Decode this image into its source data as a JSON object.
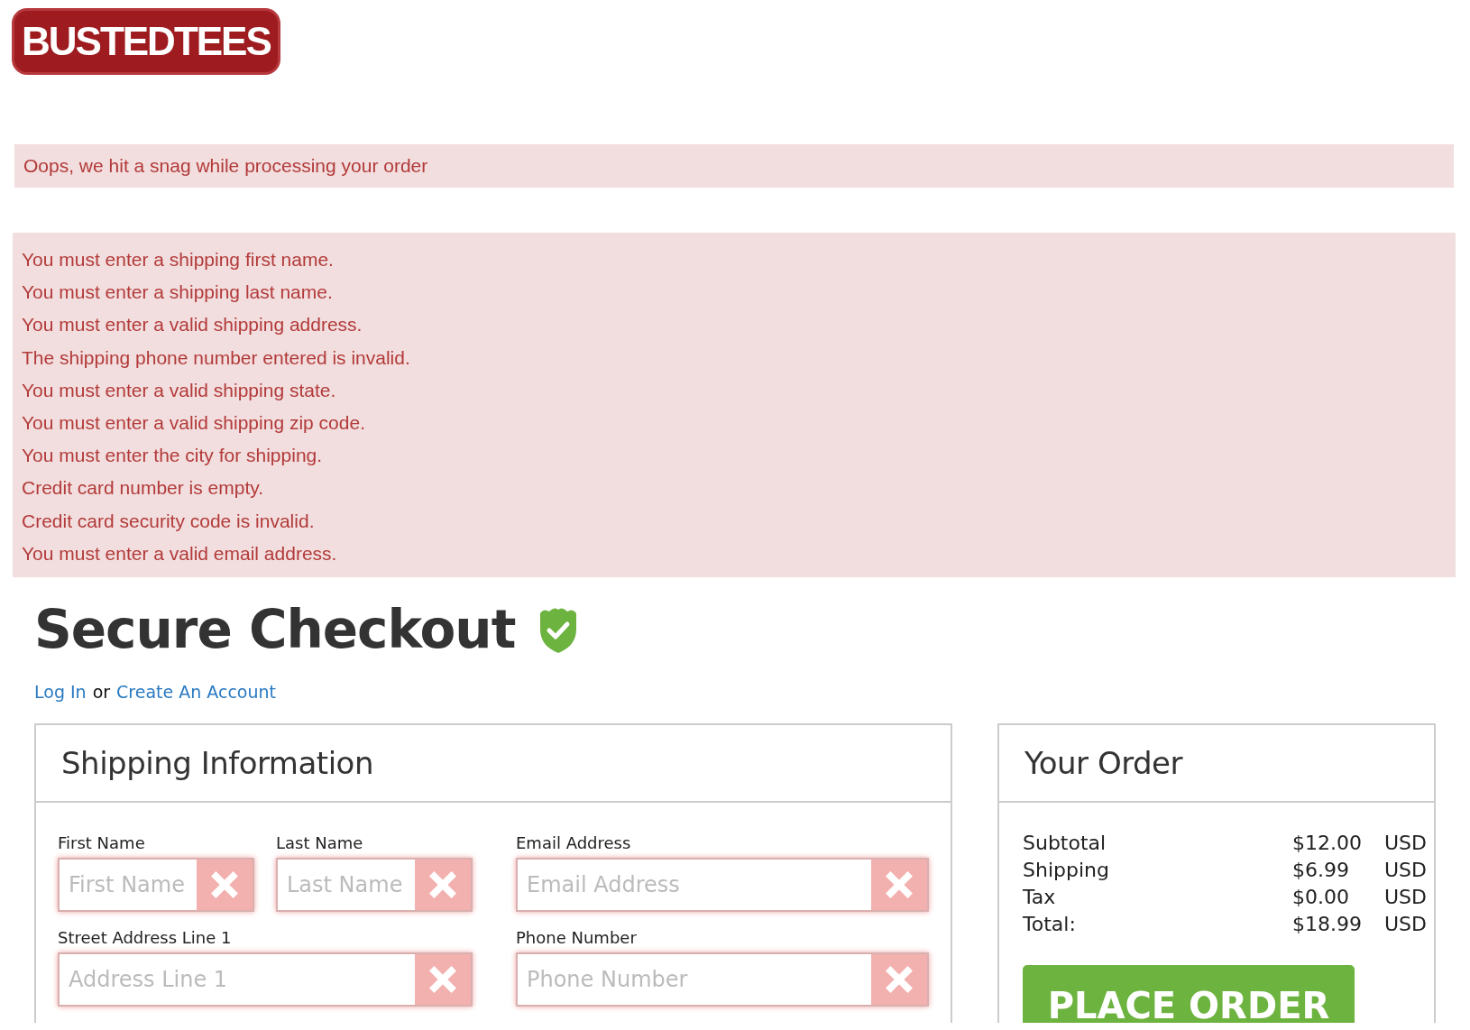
{
  "logo": {
    "text": "BUSTEDTEES"
  },
  "alert": {
    "text": "Oops, we hit a snag while processing your order"
  },
  "errors": [
    "You must enter a shipping first name.",
    "You must enter a shipping last name.",
    "You must enter a valid shipping address.",
    "The shipping phone number entered is invalid.",
    "You must enter a valid shipping state.",
    "You must enter a valid shipping zip code.",
    "You must enter the city for shipping.",
    "Credit card number is empty.",
    "Credit card security code is invalid.",
    "You must enter a valid email address."
  ],
  "heading": "Secure Checkout",
  "account_links": {
    "login": "Log In",
    "separator": "or",
    "create": "Create An Account"
  },
  "shipping": {
    "title": "Shipping Information",
    "fields": [
      {
        "label": "First Name",
        "placeholder": "First Name",
        "invalid": true
      },
      {
        "label": "Last Name",
        "placeholder": "Last Name",
        "invalid": true
      },
      {
        "label": "Email Address",
        "placeholder": "Email Address",
        "invalid": true
      },
      {
        "label": "Street Address Line 1",
        "placeholder": "Address Line 1",
        "invalid": true
      },
      {
        "label": "Phone Number",
        "placeholder": "Phone Number",
        "invalid": true
      }
    ]
  },
  "order": {
    "title": "Your Order",
    "lines": [
      {
        "label": "Subtotal",
        "amount": "$12.00",
        "currency": "USD"
      },
      {
        "label": "Shipping",
        "amount": "$6.99",
        "currency": "USD"
      },
      {
        "label": "Tax",
        "amount": "$0.00",
        "currency": "USD"
      },
      {
        "label": "Total:",
        "amount": "$18.99",
        "currency": "USD"
      }
    ],
    "button": "PLACE ORDER"
  }
}
